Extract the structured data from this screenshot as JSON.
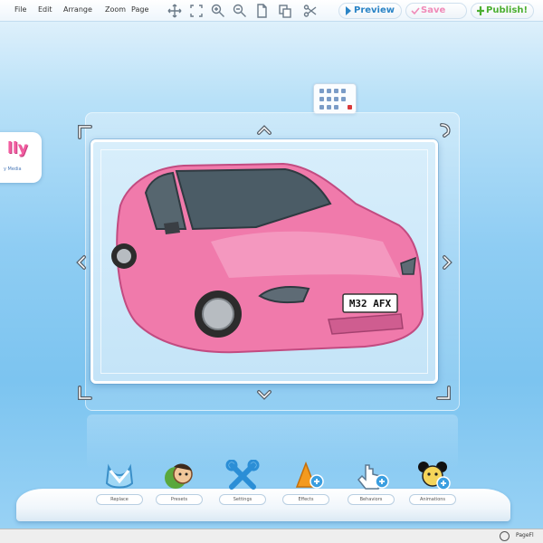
{
  "menubar": {
    "items": [
      "File",
      "Edit",
      "Arrange",
      "Zoom",
      "Page"
    ],
    "buttons": {
      "preview": "Preview",
      "save": "Save",
      "publish": "Publish!"
    }
  },
  "logo": {
    "word": "lly",
    "tagline": "y Media"
  },
  "photo": {
    "plate": "M32 AFX",
    "car_color": "#f07aab"
  },
  "dock": {
    "items": [
      "Replace",
      "Presets",
      "Settings",
      "Effects",
      "Behaviors",
      "Animations"
    ]
  },
  "status": {
    "text": "PageFl"
  },
  "colors": {
    "preview": "#2a84c6",
    "save": "#f08ab8",
    "publish": "#4caf32",
    "handle": "#56606a"
  }
}
